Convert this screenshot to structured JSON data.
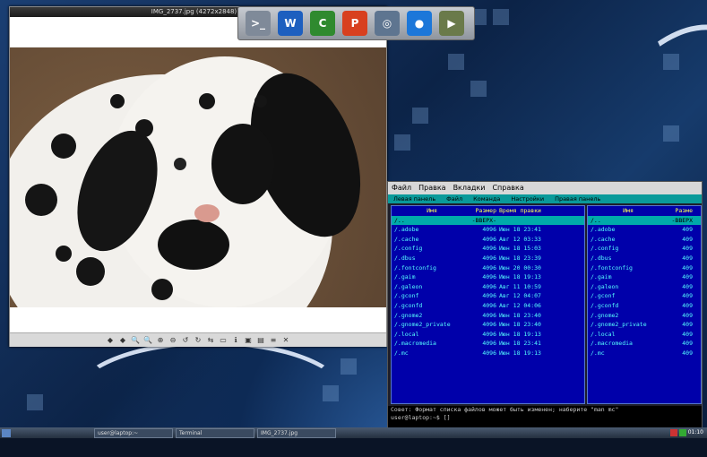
{
  "viewer": {
    "title": "IMG_2737.jpg (4272x2848) 1:",
    "toolbar_icons": [
      "prev-icon",
      "next-icon",
      "zoom-in-icon",
      "zoom-out-icon",
      "zoom-fit-icon",
      "zoom-100-icon",
      "rotate-left-icon",
      "rotate-right-icon",
      "flip-icon",
      "fullscreen-icon",
      "info-icon",
      "save-icon",
      "print-icon",
      "properties-icon",
      "close-icon"
    ]
  },
  "launcher": {
    "icons": [
      "terminal-icon",
      "writer-icon",
      "calc-icon",
      "impress-icon",
      "screenshot-icon",
      "browser-icon",
      "video-icon"
    ],
    "colors": [
      "#7f8a99",
      "#1d5fbf",
      "#2f8a2f",
      "#d8401f",
      "#5e7590",
      "#1c77d9",
      "#6a7a4a"
    ]
  },
  "mc": {
    "menu": [
      "Файл",
      "Правка",
      "Вкладки",
      "Справка"
    ],
    "bar": [
      "Левая панель",
      "Файл",
      "Команда",
      "Настройки",
      "Правая панель"
    ],
    "left": {
      "headers": {
        "name": "Имя",
        "size": "Размер",
        "time": "Время правки"
      },
      "rows": [
        {
          "name": "/..",
          "size": "-ВВЕРХ-",
          "time": ""
        },
        {
          "name": "/.adobe",
          "size": "4096",
          "time": "Июн 18 23:41"
        },
        {
          "name": "/.cache",
          "size": "4096",
          "time": "Авг 12 03:33"
        },
        {
          "name": "/.config",
          "size": "4096",
          "time": "Июн 18 15:03"
        },
        {
          "name": "/.dbus",
          "size": "4096",
          "time": "Июн 18 23:39"
        },
        {
          "name": "/.fontconfig",
          "size": "4096",
          "time": "Июн 20 00:30"
        },
        {
          "name": "/.gaim",
          "size": "4096",
          "time": "Июн 18 19:13"
        },
        {
          "name": "/.galeon",
          "size": "4096",
          "time": "Авг 11 10:59"
        },
        {
          "name": "/.gconf",
          "size": "4096",
          "time": "Авг 12 04:07"
        },
        {
          "name": "/.gconfd",
          "size": "4096",
          "time": "Авг 12 04:06"
        },
        {
          "name": "/.gnome2",
          "size": "4096",
          "time": "Июн 18 23:40"
        },
        {
          "name": "/.gnome2_private",
          "size": "4096",
          "time": "Июн 18 23:40"
        },
        {
          "name": "/.local",
          "size": "4096",
          "time": "Июн 18 19:13"
        },
        {
          "name": "/.macromedia",
          "size": "4096",
          "time": "Июн 18 23:41"
        },
        {
          "name": "/.mc",
          "size": "4096",
          "time": "Июн 18 19:13"
        }
      ]
    },
    "right": {
      "headers": {
        "name": "Имя",
        "size": "Разме"
      },
      "rows": [
        {
          "name": "/..",
          "size": "-ВВЕРХ"
        },
        {
          "name": "/.adobe",
          "size": "409"
        },
        {
          "name": "/.cache",
          "size": "409"
        },
        {
          "name": "/.config",
          "size": "409"
        },
        {
          "name": "/.dbus",
          "size": "409"
        },
        {
          "name": "/.fontconfig",
          "size": "409"
        },
        {
          "name": "/.gaim",
          "size": "409"
        },
        {
          "name": "/.galeon",
          "size": "409"
        },
        {
          "name": "/.gconf",
          "size": "409"
        },
        {
          "name": "/.gconfd",
          "size": "409"
        },
        {
          "name": "/.gnome2",
          "size": "409"
        },
        {
          "name": "/.gnome2_private",
          "size": "409"
        },
        {
          "name": "/.local",
          "size": "409"
        },
        {
          "name": "/.macromedia",
          "size": "409"
        },
        {
          "name": "/.mc",
          "size": "409"
        }
      ]
    },
    "status_line": "Совет: Формат списка файлов может быть изменен; наберите \"man mc\"",
    "prompt": "user@laptop:~$ []"
  },
  "taskbar": {
    "tasks": [
      "user@laptop:~",
      "Terminal",
      "IMG_2737.jpg"
    ],
    "clock": "01:10"
  }
}
